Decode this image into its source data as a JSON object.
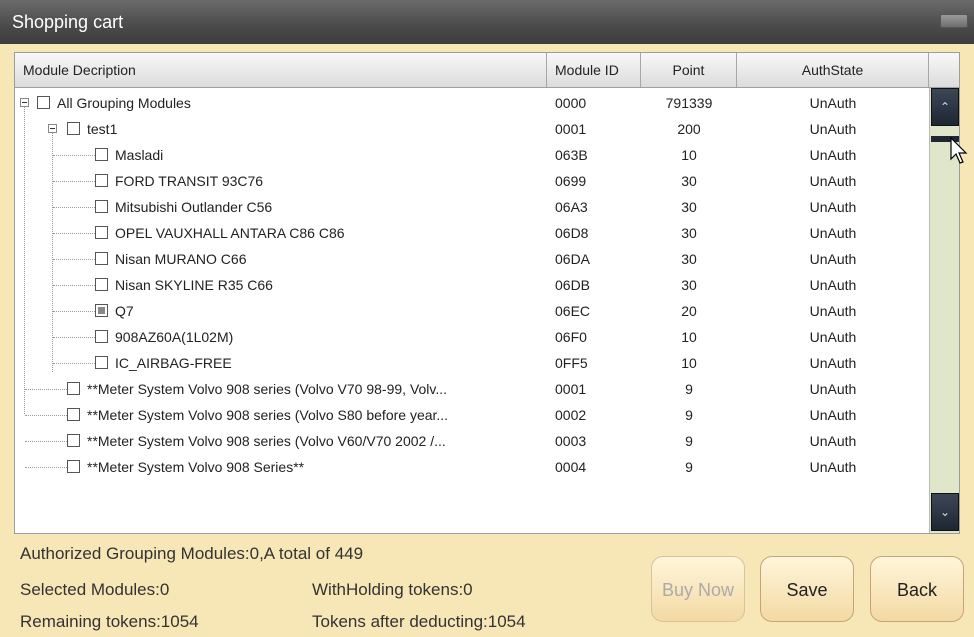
{
  "window": {
    "title": "Shopping cart"
  },
  "table": {
    "headers": {
      "description": "Module Decription",
      "module_id": "Module ID",
      "point": "Point",
      "auth_state": "AuthState"
    },
    "rows": [
      {
        "desc": "All Grouping Modules",
        "id": "0000",
        "point": "791339",
        "auth": "UnAuth",
        "level": 0,
        "expander": true
      },
      {
        "desc": "test1",
        "id": "0001",
        "point": "200",
        "auth": "UnAuth",
        "level": 1,
        "expander": true
      },
      {
        "desc": "Masladi",
        "id": "063B",
        "point": "10",
        "auth": "UnAuth",
        "level": 2
      },
      {
        "desc": "FORD  TRANSIT  93C76",
        "id": "0699",
        "point": "30",
        "auth": "UnAuth",
        "level": 2
      },
      {
        "desc": "Mitsubishi  Outlander C56",
        "id": "06A3",
        "point": "30",
        "auth": "UnAuth",
        "level": 2
      },
      {
        "desc": "OPEL VAUXHALL  ANTARA C86  C86",
        "id": "06D8",
        "point": "30",
        "auth": "UnAuth",
        "level": 2
      },
      {
        "desc": "Nisan MURANO   C66",
        "id": "06DA",
        "point": "30",
        "auth": "UnAuth",
        "level": 2
      },
      {
        "desc": "Nisan SKYLINE   R35 C66",
        "id": "06DB",
        "point": "30",
        "auth": "UnAuth",
        "level": 2
      },
      {
        "desc": "Q7",
        "id": "06EC",
        "point": "20",
        "auth": "UnAuth",
        "level": 2,
        "checked": true
      },
      {
        "desc": "908AZ60A(1L02M)",
        "id": "06F0",
        "point": "10",
        "auth": "UnAuth",
        "level": 2
      },
      {
        "desc": "IC_AIRBAG-FREE",
        "id": "0FF5",
        "point": "10",
        "auth": "UnAuth",
        "level": 2,
        "last": true
      },
      {
        "desc": "**Meter System  Volvo 908 series (Volvo V70 98-99, Volv...",
        "id": "0001",
        "point": "9",
        "auth": "UnAuth",
        "level": 1
      },
      {
        "desc": "**Meter System  Volvo 908 series (Volvo S80 before year...",
        "id": "0002",
        "point": "9",
        "auth": "UnAuth",
        "level": 1
      },
      {
        "desc": "**Meter System  Volvo 908 series (Volvo V60/V70 2002 /...",
        "id": "0003",
        "point": "9",
        "auth": "UnAuth",
        "level": 1
      },
      {
        "desc": "**Meter System  Volvo 908 Series**",
        "id": "0004",
        "point": "9",
        "auth": "UnAuth",
        "level": 1
      }
    ]
  },
  "status": {
    "authorized": "Authorized Grouping Modules:0,A total of 449",
    "selected": "Selected Modules:0",
    "withholding": "WithHolding tokens:0",
    "remaining": "Remaining tokens:1054",
    "after_deduct": "Tokens after deducting:1054"
  },
  "buttons": {
    "buy_now": "Buy Now",
    "save": "Save",
    "back": "Back"
  },
  "colors": {
    "background": "#f7e6b6",
    "titlebar": "#4a4a4a",
    "scroll_button": "#1e2633"
  }
}
